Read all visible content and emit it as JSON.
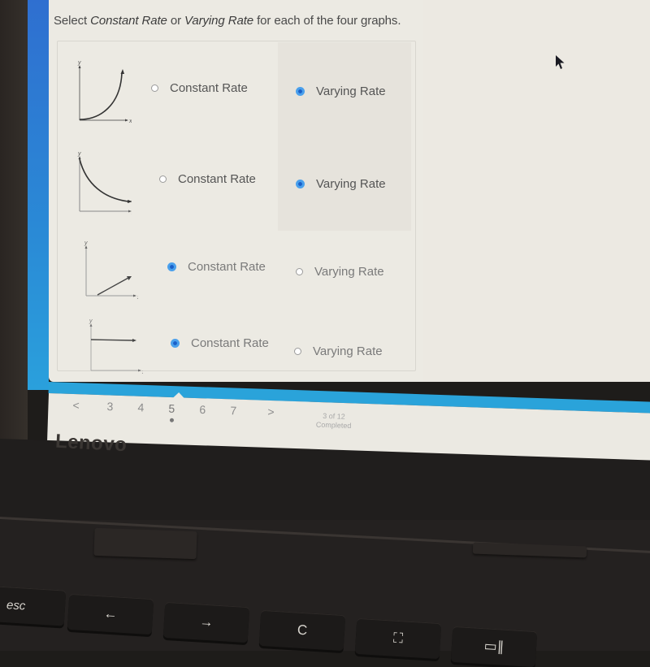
{
  "instruction": {
    "prefix": "Select ",
    "constant": "Constant Rate",
    "middle": " or ",
    "varying": "Varying Rate",
    "suffix": " for each of the four graphs."
  },
  "options": {
    "constant_label": "Constant Rate",
    "varying_label": "Varying Rate"
  },
  "questions": [
    {
      "graph": "exponential-growth-curve",
      "selected": "varying"
    },
    {
      "graph": "exponential-decay-curve",
      "selected": "varying"
    },
    {
      "graph": "increasing-line",
      "selected": "constant"
    },
    {
      "graph": "horizontal-line",
      "selected": "constant"
    }
  ],
  "axis_labels": {
    "x": "x",
    "y": "y"
  },
  "pagination": {
    "prev": "<",
    "pages": [
      "3",
      "4",
      "5",
      "6",
      "7"
    ],
    "current": "5",
    "next": ">",
    "progress_line1": "3 of 12",
    "progress_line2": "Completed"
  },
  "brand": "Lenovo",
  "keyboard": {
    "esc": "esc",
    "back": "←",
    "forward": "→",
    "refresh": "C",
    "fullscreen": "⛶",
    "overview": "▭∥"
  },
  "colors": {
    "accent": "#2aa3da",
    "radio_selected": "#3d8fe0",
    "screen_bg": "#eceae3"
  }
}
